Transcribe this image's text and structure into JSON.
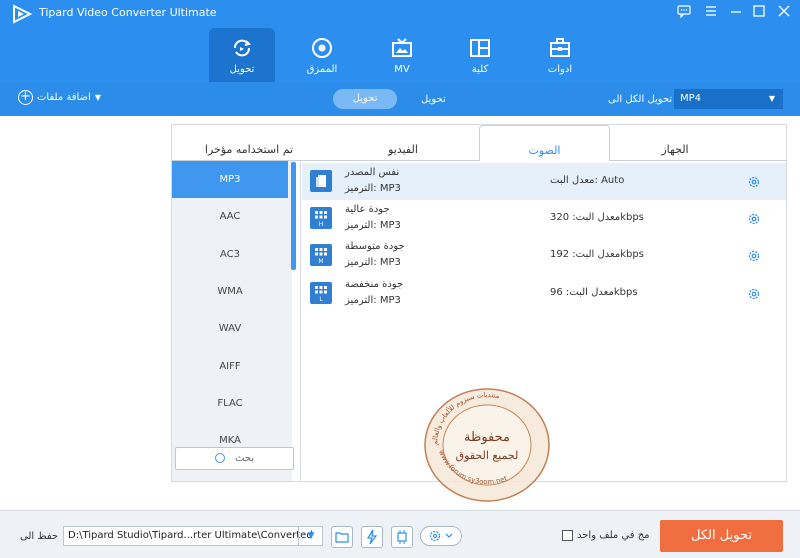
{
  "app": {
    "title": "Tipard Video Converter Ultimate"
  },
  "window_controls": [
    "feedback-icon",
    "menu-icon",
    "minimize-icon",
    "maximize-icon",
    "close-icon"
  ],
  "nav_tabs": [
    {
      "label": "تحويل",
      "icon": "convert-icon",
      "active": true
    },
    {
      "label": "الممزق",
      "icon": "ripper-icon",
      "active": false
    },
    {
      "label": "MV",
      "icon": "mv-icon",
      "active": false
    },
    {
      "label": "كلية",
      "icon": "collage-icon",
      "active": false
    },
    {
      "label": "ادوات",
      "icon": "toolbox-icon",
      "active": false
    }
  ],
  "toolbar": {
    "add_files": "اضافة ملفات",
    "converting_tab": "تحويل",
    "converted_tab": "تحويل",
    "convert_all_to_label": "تحويل الكل الى",
    "format_value": "MP4"
  },
  "format_panel": {
    "tabs": [
      {
        "label": "تم استخدامه مؤخرا",
        "active": false
      },
      {
        "label": "الفيديو",
        "active": false
      },
      {
        "label": "الصوت",
        "active": true
      },
      {
        "label": "الجهاز",
        "active": false
      }
    ],
    "formats": [
      "MP3",
      "AAC",
      "AC3",
      "WMA",
      "WAV",
      "AIFF",
      "FLAC",
      "MKA"
    ],
    "selected_format": "MP3",
    "search_placeholder": "بحث",
    "presets": [
      {
        "name": "نفس المصدر",
        "encoder": "الترميز: MP3",
        "bitrate": "معدل البت: Auto",
        "badge": ""
      },
      {
        "name": "جودة عالية",
        "encoder": "الترميز: MP3",
        "bitrate": "معدل البت: 320kbps",
        "badge": "H"
      },
      {
        "name": "جودة متوسطة",
        "encoder": "الترميز: MP3",
        "bitrate": "معدل البت: 192kbps",
        "badge": "M"
      },
      {
        "name": "جودة منخفضة",
        "encoder": "الترميز: MP3",
        "bitrate": "معدل البت: 96kbps",
        "badge": "L"
      }
    ]
  },
  "bottom": {
    "save_to_label": "حفظ الى",
    "output_path": "D:\\Tipard Studio\\Tipard...rter Ultimate\\Converted",
    "merge_label": "مج في ملف واحد",
    "convert_all_button": "تحويل الكل"
  },
  "watermark": {
    "title_line1": "محفوظة",
    "title_line2": "لجميع الحقوق",
    "ring_text": "منتديات سيزوم للألعاب والعالم",
    "url": "www.forum.sy3oom.net"
  },
  "colors": {
    "accent": "#2c8ff0",
    "convert_button": "#f06e40",
    "selected_format": "#3f97f0"
  }
}
